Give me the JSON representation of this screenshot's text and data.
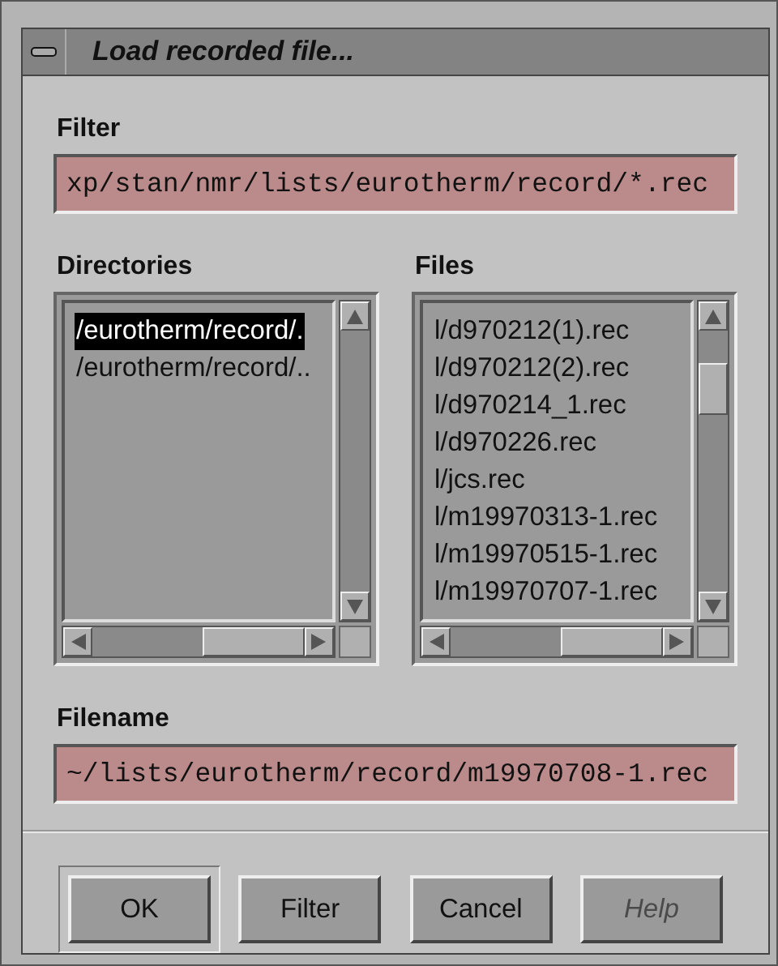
{
  "window": {
    "title": "Load recorded file..."
  },
  "filter": {
    "label": "Filter",
    "value": "xp/stan/nmr/lists/eurotherm/record/*.rec"
  },
  "directories": {
    "label": "Directories",
    "items": [
      {
        "text": "/eurotherm/record/.",
        "selected": true
      },
      {
        "text": "/eurotherm/record/..",
        "selected": false
      }
    ]
  },
  "files": {
    "label": "Files",
    "items": [
      {
        "text": "l/d970212(1).rec",
        "selected": false
      },
      {
        "text": "l/d970212(2).rec",
        "selected": false
      },
      {
        "text": "l/d970214_1.rec",
        "selected": false
      },
      {
        "text": "l/d970226.rec",
        "selected": false
      },
      {
        "text": "l/jcs.rec",
        "selected": false
      },
      {
        "text": "l/m19970313-1.rec",
        "selected": false
      },
      {
        "text": "l/m19970515-1.rec",
        "selected": false
      },
      {
        "text": "l/m19970707-1.rec",
        "selected": false
      }
    ]
  },
  "filename": {
    "label": "Filename",
    "value": "~/lists/eurotherm/record/m19970708-1.rec"
  },
  "buttons": [
    {
      "label": "OK",
      "default": true,
      "disabled": false
    },
    {
      "label": "Filter",
      "default": false,
      "disabled": false
    },
    {
      "label": "Cancel",
      "default": false,
      "disabled": false
    },
    {
      "label": "Help",
      "default": false,
      "disabled": true
    }
  ]
}
